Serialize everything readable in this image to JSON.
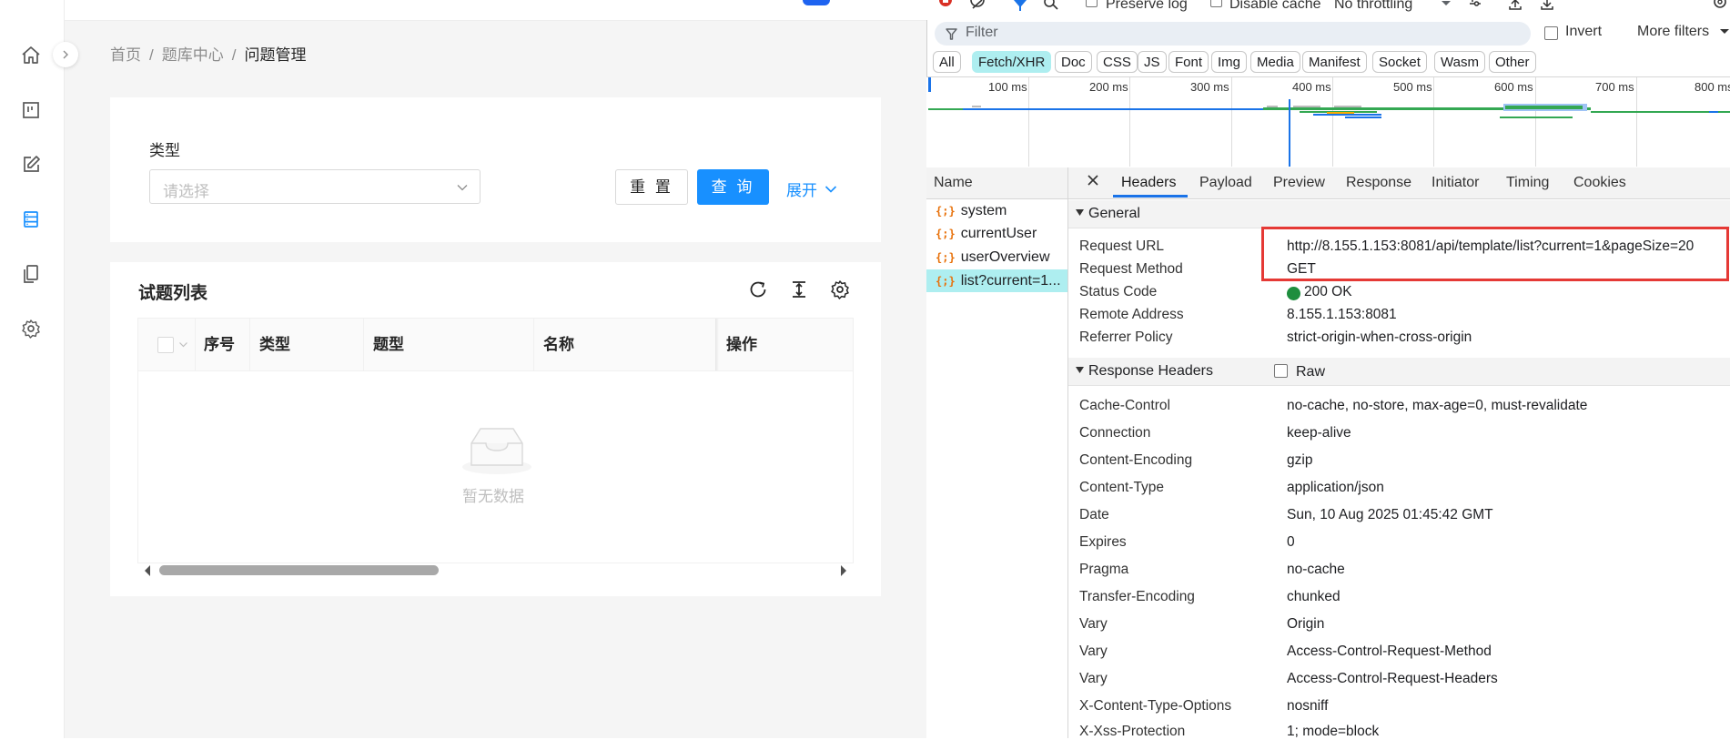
{
  "breadcrumb": [
    "首页",
    "题库中心",
    "问题管理"
  ],
  "filter": {
    "type_label": "类型",
    "type_placeholder": "请选择",
    "reset_label": "重 置",
    "query_label": "查 询",
    "expand_label": "展开"
  },
  "table": {
    "title": "试题列表",
    "columns": [
      "序号",
      "类型",
      "题型",
      "名称",
      "操作"
    ],
    "empty_text": "暂无数据"
  },
  "devtools": {
    "toolbar": {
      "preserve_log": "Preserve log",
      "disable_cache": "Disable cache",
      "throttling": "No throttling"
    },
    "filter_placeholder": "Filter",
    "invert_label": "Invert",
    "more_filters": "More filters",
    "type_chips": [
      "All",
      "Fetch/XHR",
      "Doc",
      "CSS",
      "JS",
      "Font",
      "Img",
      "Media",
      "Manifest",
      "Socket",
      "Wasm",
      "Other"
    ],
    "active_chip": "Fetch/XHR",
    "timeline_ticks": [
      "100 ms",
      "200 ms",
      "300 ms",
      "400 ms",
      "500 ms",
      "600 ms",
      "700 ms",
      "800 ms"
    ],
    "name_header": "Name",
    "requests": [
      "system",
      "currentUser",
      "userOverview",
      "list?current=1..."
    ],
    "selected_request_index": 3,
    "detail_tabs": [
      "Headers",
      "Payload",
      "Preview",
      "Response",
      "Initiator",
      "Timing",
      "Cookies"
    ],
    "active_tab": "Headers",
    "general_title": "General",
    "general": [
      {
        "k": "Request URL",
        "v": "http://8.155.1.153:8081/api/template/list?current=1&pageSize=20"
      },
      {
        "k": "Request Method",
        "v": "GET"
      },
      {
        "k": "Status Code",
        "v": "200 OK"
      },
      {
        "k": "Remote Address",
        "v": "8.155.1.153:8081"
      },
      {
        "k": "Referrer Policy",
        "v": "strict-origin-when-cross-origin"
      }
    ],
    "response_headers_title": "Response Headers",
    "raw_label": "Raw",
    "response_headers": [
      {
        "k": "Cache-Control",
        "v": "no-cache, no-store, max-age=0, must-revalidate"
      },
      {
        "k": "Connection",
        "v": "keep-alive"
      },
      {
        "k": "Content-Encoding",
        "v": "gzip"
      },
      {
        "k": "Content-Type",
        "v": "application/json"
      },
      {
        "k": "Date",
        "v": "Sun, 10 Aug 2025 01:45:42 GMT"
      },
      {
        "k": "Expires",
        "v": "0"
      },
      {
        "k": "Pragma",
        "v": "no-cache"
      },
      {
        "k": "Transfer-Encoding",
        "v": "chunked"
      },
      {
        "k": "Vary",
        "v": "Origin"
      },
      {
        "k": "Vary",
        "v": "Access-Control-Request-Method"
      },
      {
        "k": "Vary",
        "v": "Access-Control-Request-Headers"
      },
      {
        "k": "X-Content-Type-Options",
        "v": "nosniff"
      },
      {
        "k": "X-Xss-Protection",
        "v": "1; mode=block"
      }
    ]
  },
  "colors": {
    "primary": "#1890ff",
    "chip_active": "#aeeef0",
    "status_ok": "#1e8e3e",
    "highlight_box": "#e53935"
  }
}
